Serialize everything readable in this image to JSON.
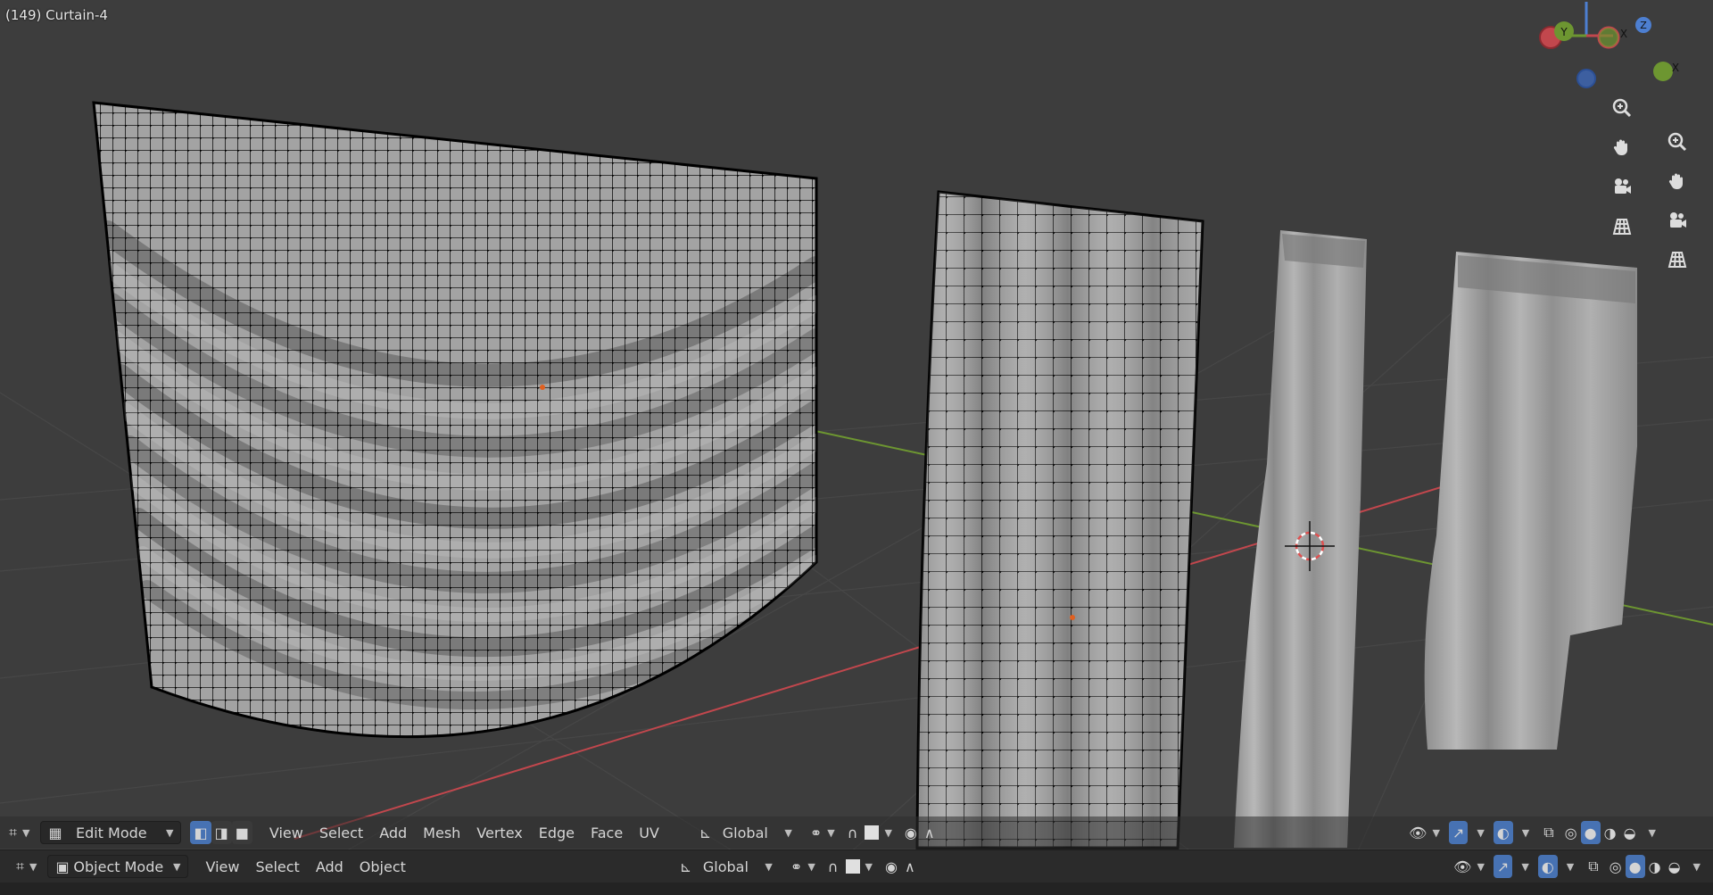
{
  "viewport": {
    "object_label": "(149) Curtain-4"
  },
  "colors": {
    "background": "#3d3d3d",
    "x_axis": "#c2474d",
    "y_axis": "#6d9631",
    "accent": "#4772b3",
    "mesh_face": "#9c9c9c",
    "wire": "#111111"
  },
  "gizmo": {
    "x_label": "X",
    "y_label": "Y",
    "z_label": "Z"
  },
  "nav_icons": [
    "zoom-icon",
    "pan-hand-icon",
    "camera-icon",
    "grid-icon"
  ],
  "edit_header": {
    "mode": "Edit Mode",
    "menus": [
      "View",
      "Select",
      "Add",
      "Mesh",
      "Vertex",
      "Edge",
      "Face",
      "UV"
    ],
    "transform_orientation": "Global"
  },
  "object_header": {
    "mode": "Object Mode",
    "menus": [
      "View",
      "Select",
      "Add",
      "Object"
    ],
    "transform_orientation": "Global"
  }
}
